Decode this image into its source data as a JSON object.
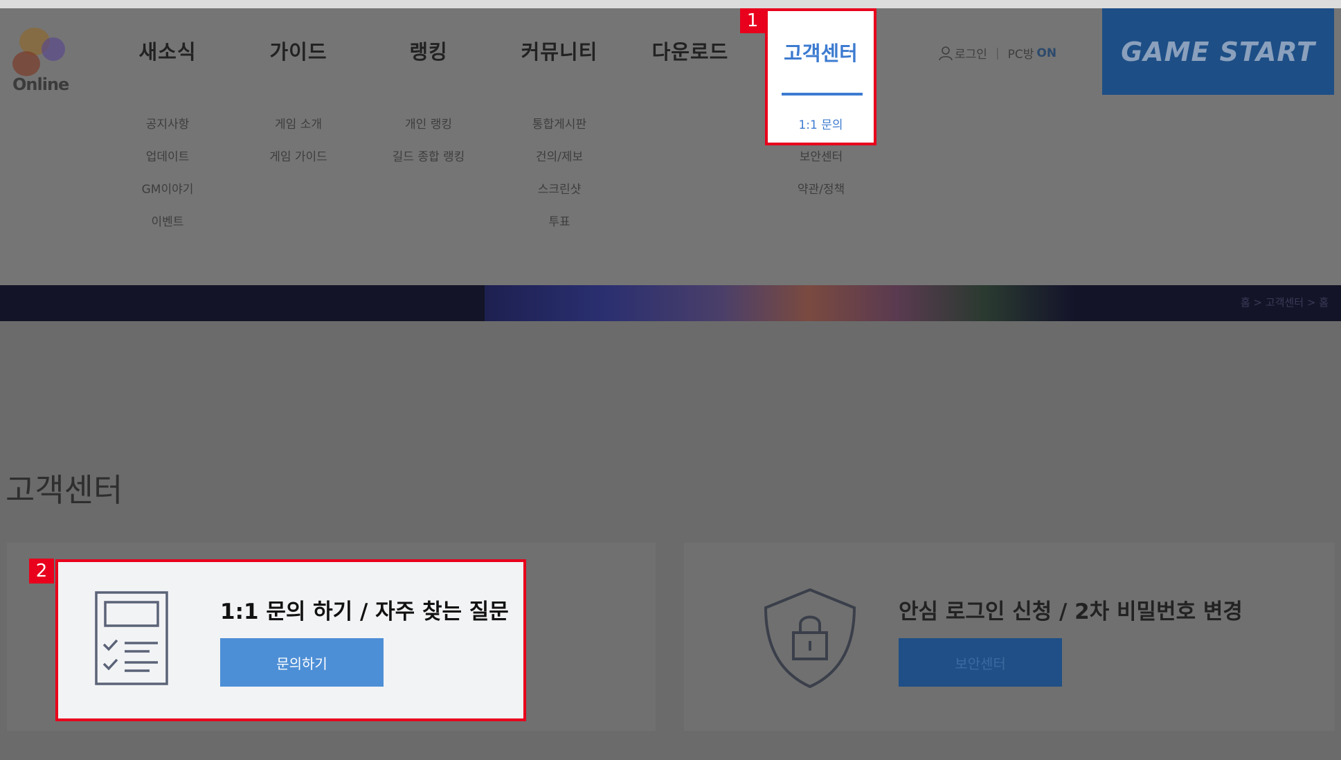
{
  "logo": {
    "text": "Online"
  },
  "nav": {
    "items": [
      {
        "label": "새소식",
        "subs": [
          "공지사항",
          "업데이트",
          "GM이야기",
          "이벤트"
        ]
      },
      {
        "label": "가이드",
        "subs": [
          "게임 소개",
          "게임 가이드"
        ]
      },
      {
        "label": "랭킹",
        "subs": [
          "개인 랭킹",
          "길드 종합 랭킹"
        ]
      },
      {
        "label": "커뮤니티",
        "subs": [
          "통합게시판",
          "건의/제보",
          "스크린샷",
          "투표"
        ]
      },
      {
        "label": "다운로드",
        "subs": []
      }
    ],
    "support": {
      "label": "고객센터",
      "subs": [
        "1:1 문의",
        "보안센터",
        "약관/정책"
      ]
    }
  },
  "header": {
    "login": "로그인",
    "pc_label": "PC방",
    "pc_status": "ON",
    "game_start": "GAME START"
  },
  "breadcrumb": "홈  >  고객센터  >  홈",
  "page_title": "고객센터",
  "cards": {
    "inquiry": {
      "title": "1:1 문의 하기 / 자주 찾는 질문",
      "button": "문의하기"
    },
    "security": {
      "title": "안심 로그인 신청 / 2차 비밀번호 변경",
      "button": "보안센터"
    }
  },
  "annotations": {
    "badge1": "1",
    "badge2": "2"
  },
  "colors": {
    "accent": "#3d7bd0",
    "highlight": "#e8001c",
    "button": "#4d8fd6",
    "game_start": "#1d4e86"
  }
}
